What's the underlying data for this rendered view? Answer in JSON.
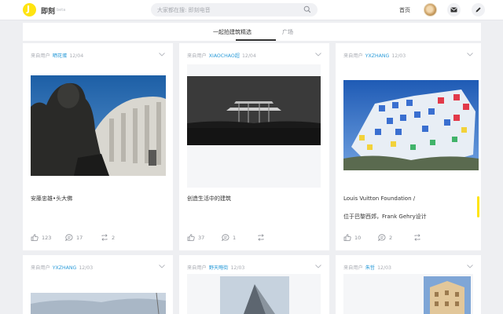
{
  "nav": {
    "brand": "即刻",
    "beta": "beta",
    "logo_letter": "J",
    "search_placeholder": "大家都在搜: 即刻电音",
    "home": "首页"
  },
  "tabs": [
    {
      "label": "一起拍建筑精选",
      "active": true
    },
    {
      "label": "广场",
      "active": false
    }
  ],
  "cards": [
    {
      "source": "来自用户",
      "user": "晒花蛋",
      "date": "12/04",
      "caption_lines": [
        "安藤忠雄•头大佛"
      ],
      "likes": "123",
      "comments": "17",
      "shares": "2"
    },
    {
      "source": "来自用户",
      "user": "XIAOCHAO超",
      "date": "12/04",
      "caption_lines": [
        "创造生活中的建筑"
      ],
      "likes": "37",
      "comments": "1",
      "shares": ""
    },
    {
      "source": "来自用户",
      "user": "YXZHANG",
      "date": "12/03",
      "caption_lines": [
        "Louis Vuitton Foundation /",
        "位于巴黎西郊，Frank Gehry设计"
      ],
      "likes": "10",
      "comments": "2",
      "shares": ""
    },
    {
      "source": "来自用户",
      "user": "YXZHANG",
      "date": "12/03"
    },
    {
      "source": "来自用户",
      "user": "野天略街",
      "date": "12/03"
    },
    {
      "source": "来自用户",
      "user": "朱哲",
      "date": "12/03"
    }
  ],
  "colors": {
    "accent": "#ffe411",
    "link": "#2c9cd9",
    "page_bg": "#eeeff2"
  }
}
